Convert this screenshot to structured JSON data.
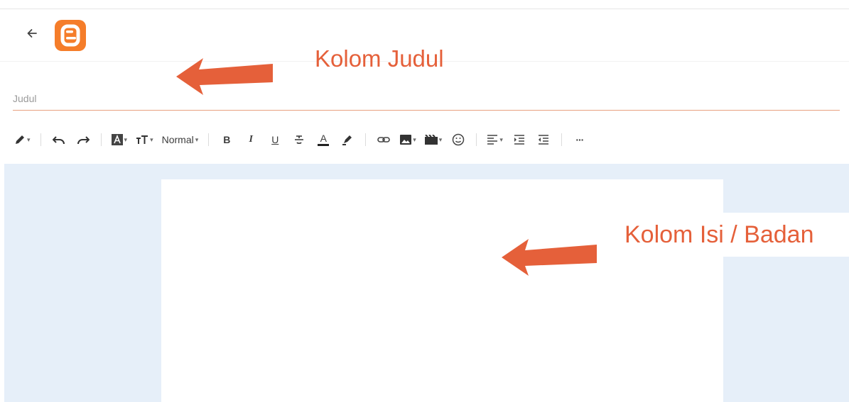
{
  "header": {
    "back_icon": "arrow-left-icon",
    "logo_icon": "blogger-logo-icon",
    "brand_color": "#f57d2a"
  },
  "annotations": {
    "title_label": "Kolom Judul",
    "body_label": "Kolom Isi / Badan",
    "color": "#e5603a"
  },
  "title_field": {
    "placeholder": "Judul",
    "value": ""
  },
  "toolbar": {
    "mode_icon": "pencil-icon",
    "undo_icon": "undo-icon",
    "redo_icon": "redo-icon",
    "font_icon": "font-icon",
    "font_size_icon": "font-size-icon",
    "format_label": "Normal",
    "bold_label": "B",
    "italic_label": "I",
    "underline_label": "U",
    "strikethrough_icon": "strikethrough-icon",
    "text_color_label": "A",
    "highlight_icon": "highlighter-icon",
    "link_icon": "link-icon",
    "image_icon": "image-icon",
    "video_icon": "video-icon",
    "emoji_icon": "emoji-icon",
    "align_icon": "align-left-icon",
    "indent_icon": "indent-icon",
    "outdent_icon": "outdent-icon",
    "more_label": "···"
  },
  "editor": {
    "canvas_color": "#e6eff9",
    "page_color": "#ffffff"
  }
}
